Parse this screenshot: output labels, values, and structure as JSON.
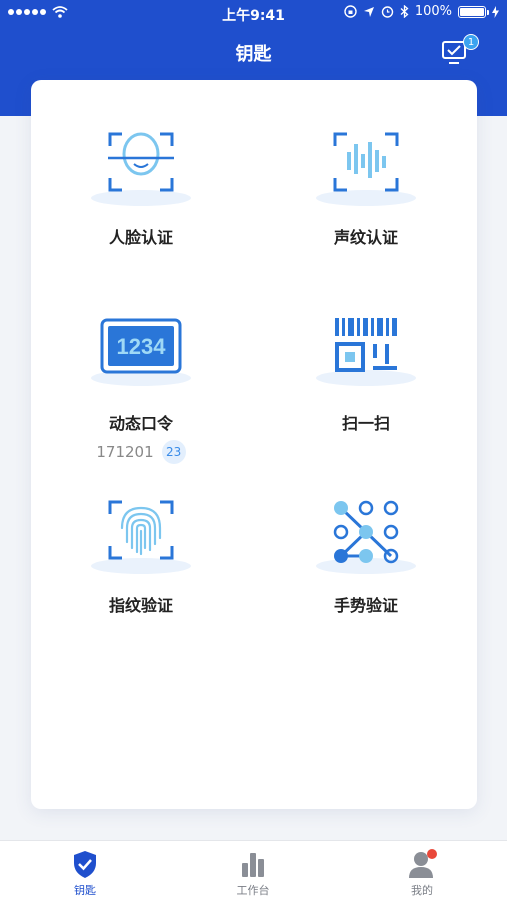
{
  "status_bar": {
    "time": "上午9:41",
    "battery": "100%"
  },
  "header": {
    "title": "钥匙",
    "action_icon": "checklist-icon",
    "action_badge": "1"
  },
  "colors": {
    "brand": "#1f4fcd",
    "accent": "#3a8ce8",
    "light_accent": "#7cc6ef"
  },
  "auth_methods": [
    {
      "label": "人脸认证",
      "icon": "face-scan-icon"
    },
    {
      "label": "声纹认证",
      "icon": "voiceprint-icon"
    },
    {
      "label": "动态口令",
      "icon": "dynamic-code-icon",
      "icon_text": "1234",
      "code": "171201",
      "seconds_left": "23"
    },
    {
      "label": "扫一扫",
      "icon": "scan-qr-icon"
    },
    {
      "label": "指纹验证",
      "icon": "fingerprint-icon"
    },
    {
      "label": "手势验证",
      "icon": "gesture-pattern-icon"
    }
  ],
  "tabbar": {
    "items": [
      {
        "label": "钥匙",
        "icon": "shield-check-icon",
        "active": true
      },
      {
        "label": "工作台",
        "icon": "bar-chart-icon",
        "active": false
      },
      {
        "label": "我的",
        "icon": "user-icon",
        "active": false
      }
    ]
  }
}
